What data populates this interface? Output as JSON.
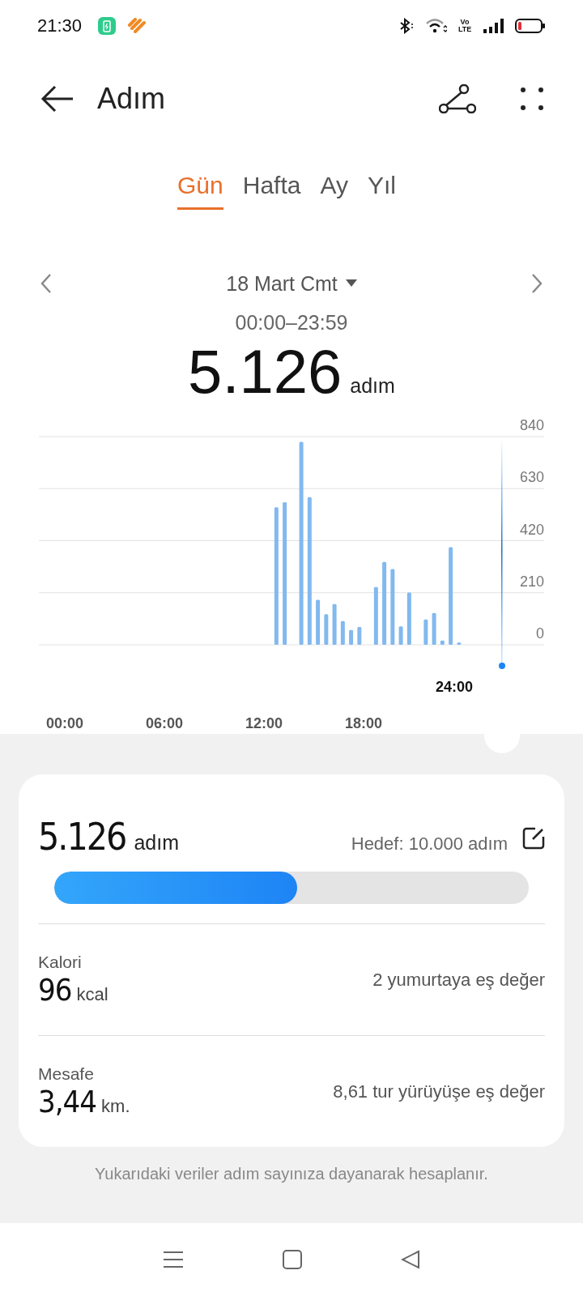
{
  "status_bar": {
    "time": "21:30",
    "network_label": "Vo LTE"
  },
  "header": {
    "title": "Adım"
  },
  "tabs": [
    {
      "label": "Gün",
      "selected": true
    },
    {
      "label": "Hafta",
      "selected": false
    },
    {
      "label": "Ay",
      "selected": false
    },
    {
      "label": "Yıl",
      "selected": false
    }
  ],
  "date": {
    "label": "18 Mart Cmt",
    "range": "00:00–23:59",
    "total": "5.126",
    "unit": "adım"
  },
  "chart_data": {
    "type": "bar",
    "x": [
      12.5,
      13,
      14,
      14.5,
      15,
      15.5,
      16,
      16.5,
      17,
      17.5,
      18.5,
      19,
      19.5,
      20,
      20.5,
      21.5,
      22,
      22.5,
      23,
      23.5
    ],
    "values": [
      555,
      575,
      819,
      596,
      181,
      123,
      164,
      96,
      60,
      72,
      233,
      334,
      306,
      74,
      211,
      102,
      128,
      17,
      394,
      9
    ],
    "xlim": [
      0,
      24
    ],
    "ylim": [
      0,
      840
    ],
    "xticks": [
      {
        "value": 0,
        "label": "00:00"
      },
      {
        "value": 6,
        "label": "06:00"
      },
      {
        "value": 12,
        "label": "12:00"
      },
      {
        "value": 18,
        "label": "18:00"
      }
    ],
    "yticks": [
      0,
      210,
      420,
      630,
      840
    ],
    "grid": true
  },
  "cursor": {
    "time": "24:00"
  },
  "summary": {
    "steps": "5.126",
    "steps_unit": "adım",
    "goal": "Hedef: 10.000 adım",
    "level": 0.5126,
    "stats": [
      {
        "label": "Kalori",
        "value": "96",
        "unit": "kcal",
        "equivalent": "2 yumurtaya eş değer"
      },
      {
        "label": "Mesafe",
        "value": "3,44",
        "unit": "km.",
        "equivalent": "8,61 tur yürüyüşe eş değer"
      }
    ]
  },
  "footnote": "Yukarıdaki veriler adım sayınıza dayanarak hesaplanır."
}
